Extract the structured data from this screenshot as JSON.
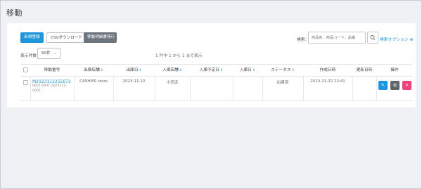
{
  "page": {
    "title": "移動"
  },
  "toolbar": {
    "new_label": "新規登録",
    "csv_label": "CSVダウンロード",
    "issue_label": "移動明細書発行"
  },
  "search": {
    "label": "検索：",
    "placeholder": "商品名、商品コード、品番",
    "options_label": "検索オプション"
  },
  "pagination": {
    "per_page_label": "表示件数",
    "per_page_value": "50件",
    "count_text": "1 件中 1 から 1 まで表示"
  },
  "table": {
    "headers": [
      "移動番号",
      "出庫店舗",
      "出庫日",
      "入庫店舗",
      "入庫予定日",
      "入庫日",
      "ステータス",
      "作成日時",
      "更新日時",
      "操作"
    ],
    "rows": [
      {
        "id": "M2023112255672",
        "sub": "0001-0007-2023112-0001",
        "from_store": "CASHIER store",
        "ship_date": "2023-11-22",
        "to_store": "小売店",
        "planned_date": "",
        "arrival_date": "",
        "status": "出庫済",
        "created": "2023-11-22 13:41",
        "updated": ""
      }
    ]
  },
  "colors": {
    "accent": "#1e96dc",
    "danger": "#f04078",
    "secondary": "#6c757d"
  }
}
